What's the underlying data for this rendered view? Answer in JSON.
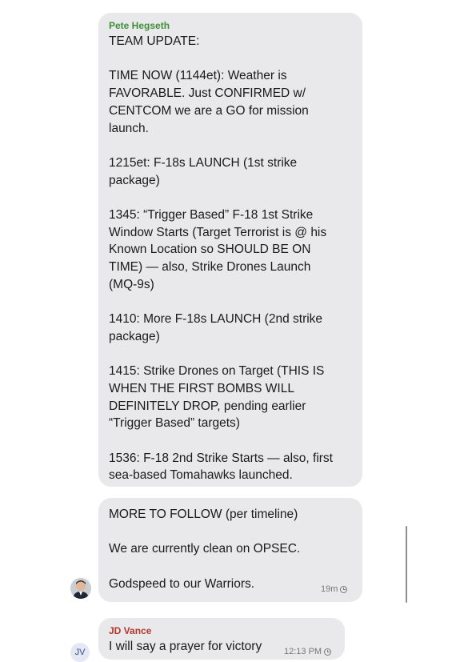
{
  "messages": [
    {
      "sender": "Pete Hegseth",
      "paragraphs": [
        "TEAM UPDATE:",
        "TIME NOW (1144et): Weather is\nFAVORABLE. Just CONFIRMED w/\nCENTCOM we are a GO for mission\nlaunch.",
        "1215et: F-18s LAUNCH (1st strike\npackage)",
        "1345: “Trigger Based” F-18 1st Strike\nWindow Starts (Target Terrorist is @ his\nKnown Location so SHOULD BE ON\nTIME) — also, Strike Drones Launch\n(MQ-9s)",
        "1410: More F-18s LAUNCH (2nd strike\npackage)",
        "1415: Strike Drones on Target (THIS IS\nWHEN THE FIRST BOMBS WILL\nDEFINITELY DROP, pending earlier\n“Trigger Based” targets)",
        "1536: F-18 2nd Strike Starts — also, first\nsea-based Tomahawks launched."
      ]
    },
    {
      "paragraphs": [
        "MORE TO FOLLOW (per timeline)",
        "We are currently clean on OPSEC.",
        "Godspeed to our Warriors."
      ],
      "time": "19m",
      "status_icon": "clock-icon"
    },
    {
      "sender": "JD Vance",
      "avatar_initials": "JV",
      "paragraphs": [
        "I will say a prayer for victory"
      ],
      "time": "12:13 PM",
      "status_icon": "clock-icon"
    }
  ],
  "colors": {
    "bubble": "#e9e9eb",
    "sender_hegseth": "#3e8e3a",
    "sender_vance": "#b4372f"
  }
}
